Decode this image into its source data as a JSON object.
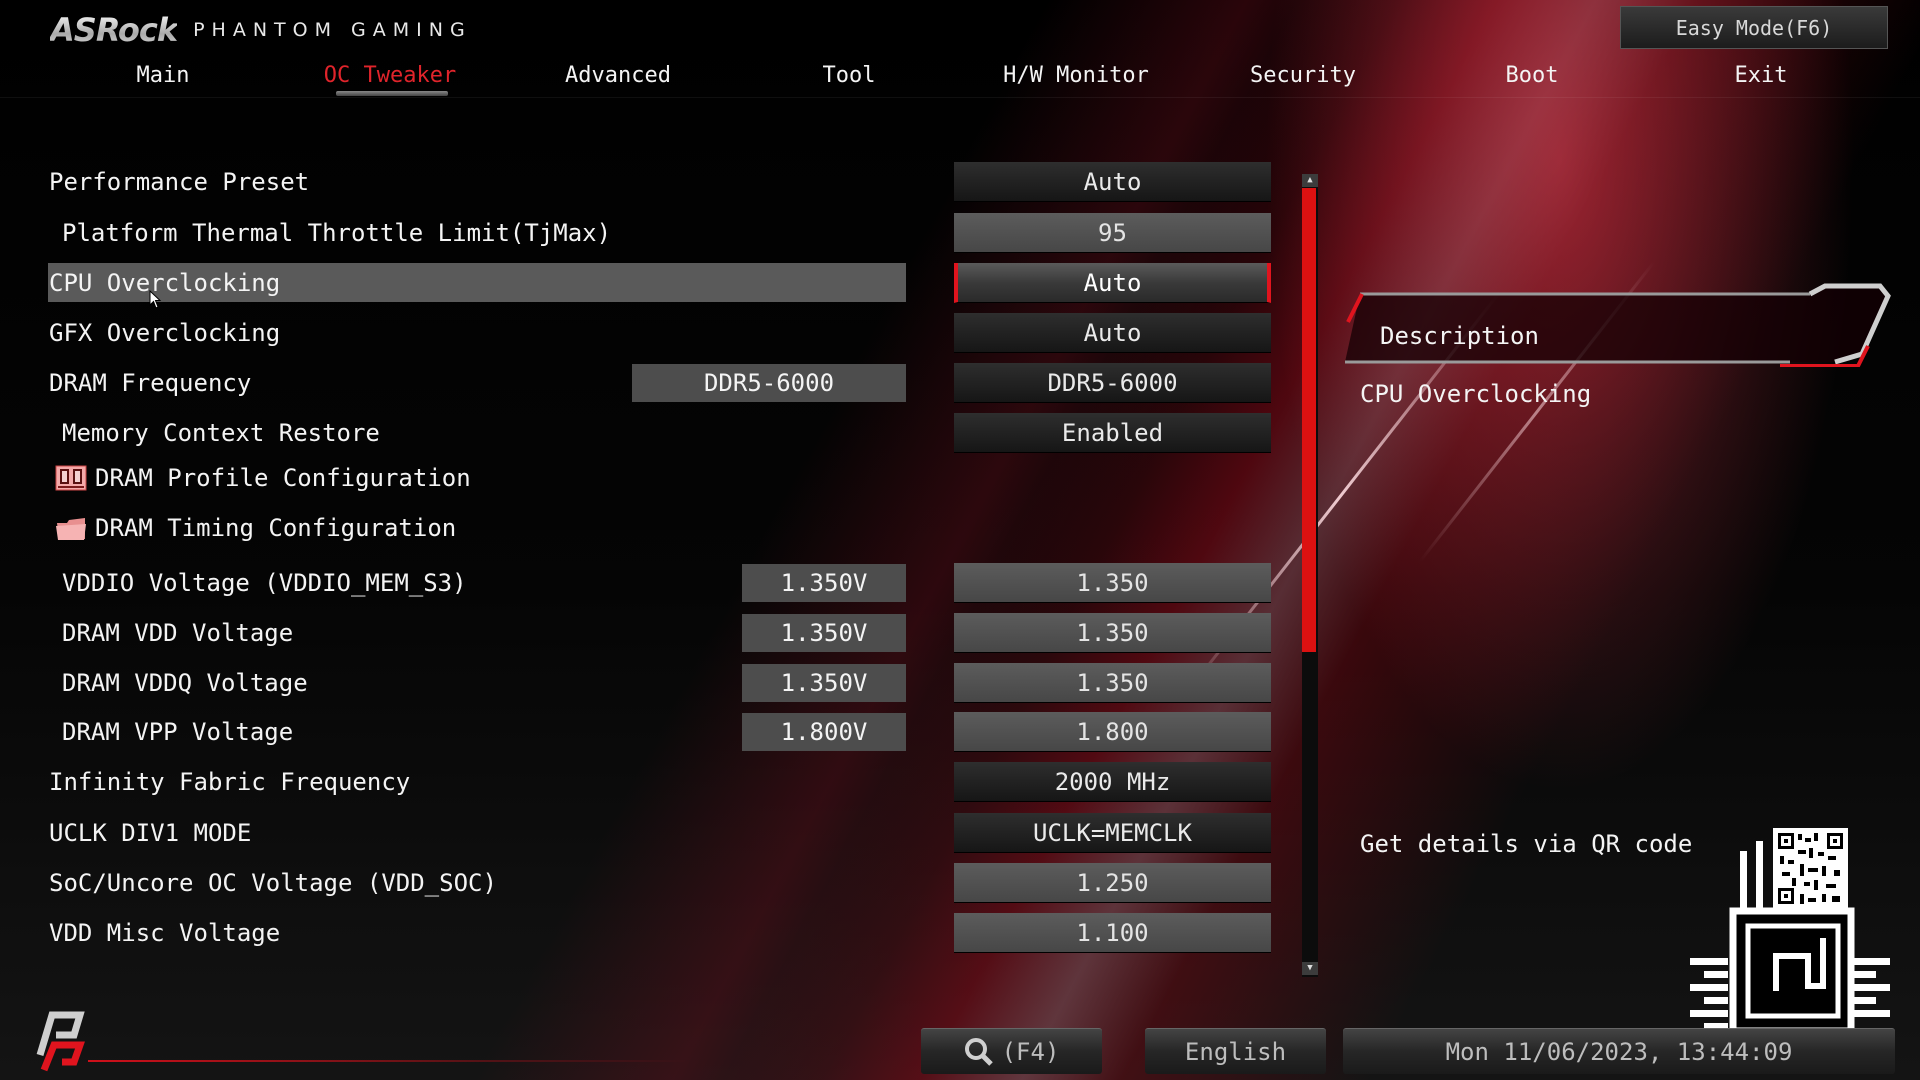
{
  "header": {
    "brand": "ASRock",
    "brand_sub": "PHANTOM GAMING",
    "easy_mode_label": "Easy Mode(F6)"
  },
  "tabs": [
    {
      "label": "Main",
      "active": false
    },
    {
      "label": "OC Tweaker",
      "active": true
    },
    {
      "label": "Advanced",
      "active": false
    },
    {
      "label": "Tool",
      "active": false
    },
    {
      "label": "H/W Monitor",
      "active": false
    },
    {
      "label": "Security",
      "active": false
    },
    {
      "label": "Boot",
      "active": false
    },
    {
      "label": "Exit",
      "active": false
    }
  ],
  "settings": [
    {
      "label": "Performance Preset",
      "value": "Auto"
    },
    {
      "label": "Platform Thermal Throttle Limit(TjMax)",
      "value": "95"
    },
    {
      "label": "CPU Overclocking",
      "value": "Auto",
      "selected": true
    },
    {
      "label": "GFX Overclocking",
      "value": "Auto"
    },
    {
      "label": "DRAM Frequency",
      "current": "DDR5-6000",
      "value": "DDR5-6000"
    },
    {
      "label": "Memory Context Restore",
      "value": "Enabled"
    },
    {
      "label": "DRAM Profile Configuration",
      "icon": "memory-chip-icon"
    },
    {
      "label": "DRAM Timing Configuration",
      "icon": "folder-icon"
    },
    {
      "label": "VDDIO Voltage (VDDIO_MEM_S3)",
      "current": "1.350V",
      "value": "1.350"
    },
    {
      "label": "DRAM VDD Voltage",
      "current": "1.350V",
      "value": "1.350"
    },
    {
      "label": "DRAM VDDQ Voltage",
      "current": "1.350V",
      "value": "1.350"
    },
    {
      "label": "DRAM VPP Voltage",
      "current": "1.800V",
      "value": "1.800"
    },
    {
      "label": "Infinity Fabric Frequency",
      "value": "2000 MHz"
    },
    {
      "label": "UCLK DIV1 MODE",
      "value": "UCLK=MEMCLK"
    },
    {
      "label": "SoC/Uncore OC Voltage (VDD_SOC)",
      "value": "1.250"
    },
    {
      "label": "VDD Misc Voltage",
      "value": "1.100"
    }
  ],
  "scrollbar": {
    "thumb_start": 0.0,
    "thumb_fraction": 0.6
  },
  "description": {
    "title": "Description",
    "text": "CPU Overclocking",
    "qr_label": "Get details via QR code"
  },
  "footer": {
    "search_label": "(F4)",
    "language": "English",
    "datetime": "Mon 11/06/2023, 13:44:09"
  },
  "colors": {
    "accent": "#e0242b",
    "scroll_thumb": "#dc1111"
  }
}
